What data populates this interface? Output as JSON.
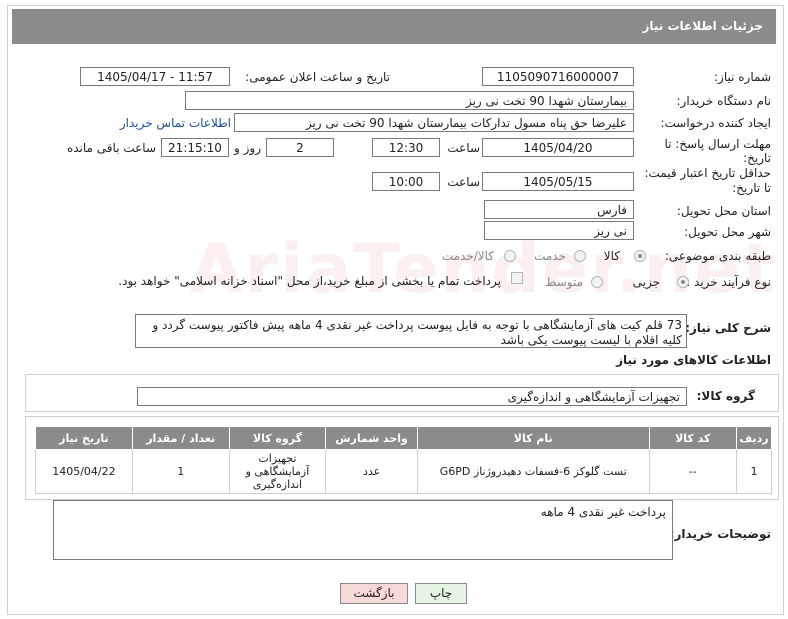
{
  "header": {
    "title": "جزئیات اطلاعات نیاز"
  },
  "watermark": {
    "text": "AriaTender.net"
  },
  "form": {
    "need_number_label": "شماره نیاز:",
    "need_number": "1105090716000007",
    "announce_label": "تاریخ و ساعت اعلان عمومی:",
    "announce_value": "1405/04/17 - 11:57",
    "buyer_org_label": "نام دستگاه خریدار:",
    "buyer_org": "بیمارستان شهدا 90 تخت نی ریز",
    "creator_label": "ایجاد کننده درخواست:",
    "creator": "علیرضا حق پناه مسول تدارکات بیمارستان شهدا 90 تخت نی ریز",
    "contact_link": "اطلاعات تماس خریدار",
    "deadline_label_1": "مهلت ارسال پاسخ: تا",
    "deadline_label_2": "تاریخ:",
    "deadline_date": "1405/04/20",
    "time_label": "ساعت",
    "deadline_time": "12:30",
    "days": "2",
    "days_label": "روز و",
    "remaining_time": "21:15:10",
    "remaining_label": "ساعت باقی مانده",
    "validity_label_1": "حداقل تاریخ اعتبار قیمت:",
    "validity_label_2": "تا تاریخ:",
    "validity_date": "1405/05/15",
    "validity_time": "10:00",
    "province_label": "استان محل تحویل:",
    "province": "فارس",
    "city_label": "شهر محل تحویل:",
    "city": "نی ریز",
    "category_label": "طبقه بندی موضوعی:",
    "category_options": [
      "کالا",
      "خدمت",
      "کالا/خدمت"
    ],
    "process_label": "نوع فرآیند خرید :",
    "process_options": [
      "جزیی",
      "متوسط"
    ],
    "payment_note": "پرداخت تمام یا بخشی از مبلغ خرید،از محل \"اسناد خزانه اسلامی\" خواهد بود."
  },
  "description": {
    "label": "شرح کلی نیاز:",
    "text": "73 قلم کیت های آزمایشگاهی با توجه به فایل پیوست پرداخت غیر نقدی 4 ماهه  پیش فاکتور پیوست گردد و کلیه اقلام با لیست پیوست یکی باشد"
  },
  "goods_info": {
    "title": "اطلاعات کالاهای مورد نیاز",
    "group_label": "گروه کالا:",
    "group_value": "تجهیزات آزمایشگاهی و اندازه‌گیری"
  },
  "table": {
    "headers": [
      "ردیف",
      "کد کالا",
      "نام کالا",
      "واحد شمارش",
      "گروه کالا",
      "تعداد / مقدار",
      "تاریخ نیاز"
    ],
    "rows": [
      [
        "1",
        "--",
        "تست گلوکز 6-فسفات دهیدروژناز G6PD",
        "عدد",
        "تجهیزات آزمایشگاهی و اندازه‌گیری",
        "1",
        "1405/04/22"
      ]
    ]
  },
  "buyer_notes": {
    "label": "توضیحات خریدار:",
    "text": "پرداخت غیر نقدی 4 ماهه"
  },
  "buttons": {
    "print": "چاپ",
    "back": "بازگشت"
  },
  "colors": {
    "header_bg": "#8b8b8b",
    "link": "#1d4f9a",
    "print_btn": "#e7f6e4",
    "back_btn": "#f8d9d9"
  }
}
